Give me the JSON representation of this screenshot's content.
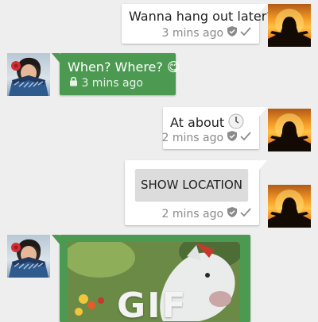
{
  "messages": [
    {
      "text": "Wanna hang out later?",
      "time": "3 mins ago"
    },
    {
      "text": "When? Where? 😋",
      "time": "3 mins ago"
    },
    {
      "text": "At about",
      "time": "2 mins ago"
    },
    {
      "button": "SHOW LOCATION",
      "time": "2 mins ago"
    },
    {
      "gif_label": "GIF"
    }
  ],
  "icons": [
    "shield-icon",
    "check-icon",
    "lock-icon",
    "clock-emoji-icon",
    "grinning-tongue-emoji-icon"
  ],
  "colors": {
    "background": "#eeeeee",
    "incoming_bubble": "#4c9a52",
    "outgoing_bubble": "#ffffff",
    "button": "#dcdcdc"
  }
}
